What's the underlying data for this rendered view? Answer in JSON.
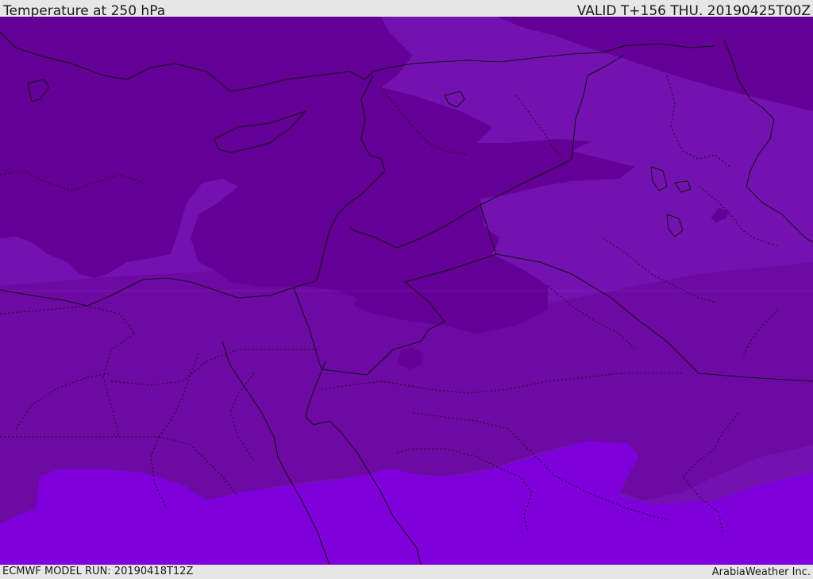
{
  "header": {
    "title": "Temperature at 250 hPa",
    "valid": "VALID T+156 THU. 20190425T00Z"
  },
  "footer": {
    "model_run": "ECMWF MODEL RUN: 20190418T12Z",
    "credit": "ArabiaWeather Inc."
  },
  "map": {
    "field": "temperature-250hpa",
    "colors": {
      "coldest": "#650097",
      "cold": "#6d0aa4",
      "mid": "#7412b1",
      "warm": "#7e00db",
      "border": "#111111"
    }
  }
}
